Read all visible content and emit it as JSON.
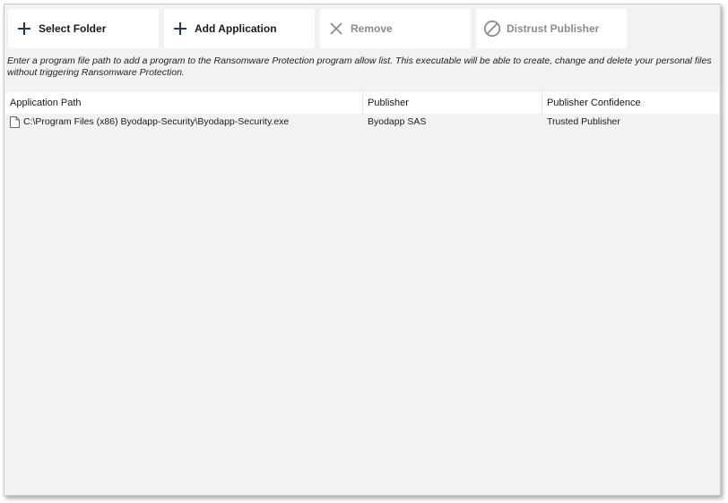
{
  "toolbar": {
    "select_folder_label": "Select Folder",
    "add_application_label": "Add Application",
    "remove_label": "Remove",
    "distrust_publisher_label": "Distrust Publisher"
  },
  "icons": {
    "select_folder": "plus-icon",
    "add_application": "plus-icon",
    "remove": "close-icon",
    "distrust_publisher": "prohibited-icon",
    "row": "file-icon"
  },
  "colors": {
    "plus_icon": "#1f3b57",
    "disabled": "#8c8c8c",
    "background": "#f2f2f2"
  },
  "description": "Enter a program file path to add a program to the Ransomware Protection program allow list. This executable will be able to create, change and delete your personal files without triggering Ransomware Protection.",
  "table": {
    "columns": [
      "Application Path",
      "Publisher",
      "Publisher Confidence"
    ],
    "rows": [
      {
        "path": "C:\\Program Files (x86) Byodapp-Security\\Byodapp-Security.exe",
        "publisher": "Byodapp SAS",
        "confidence": "Trusted Publisher"
      }
    ]
  }
}
